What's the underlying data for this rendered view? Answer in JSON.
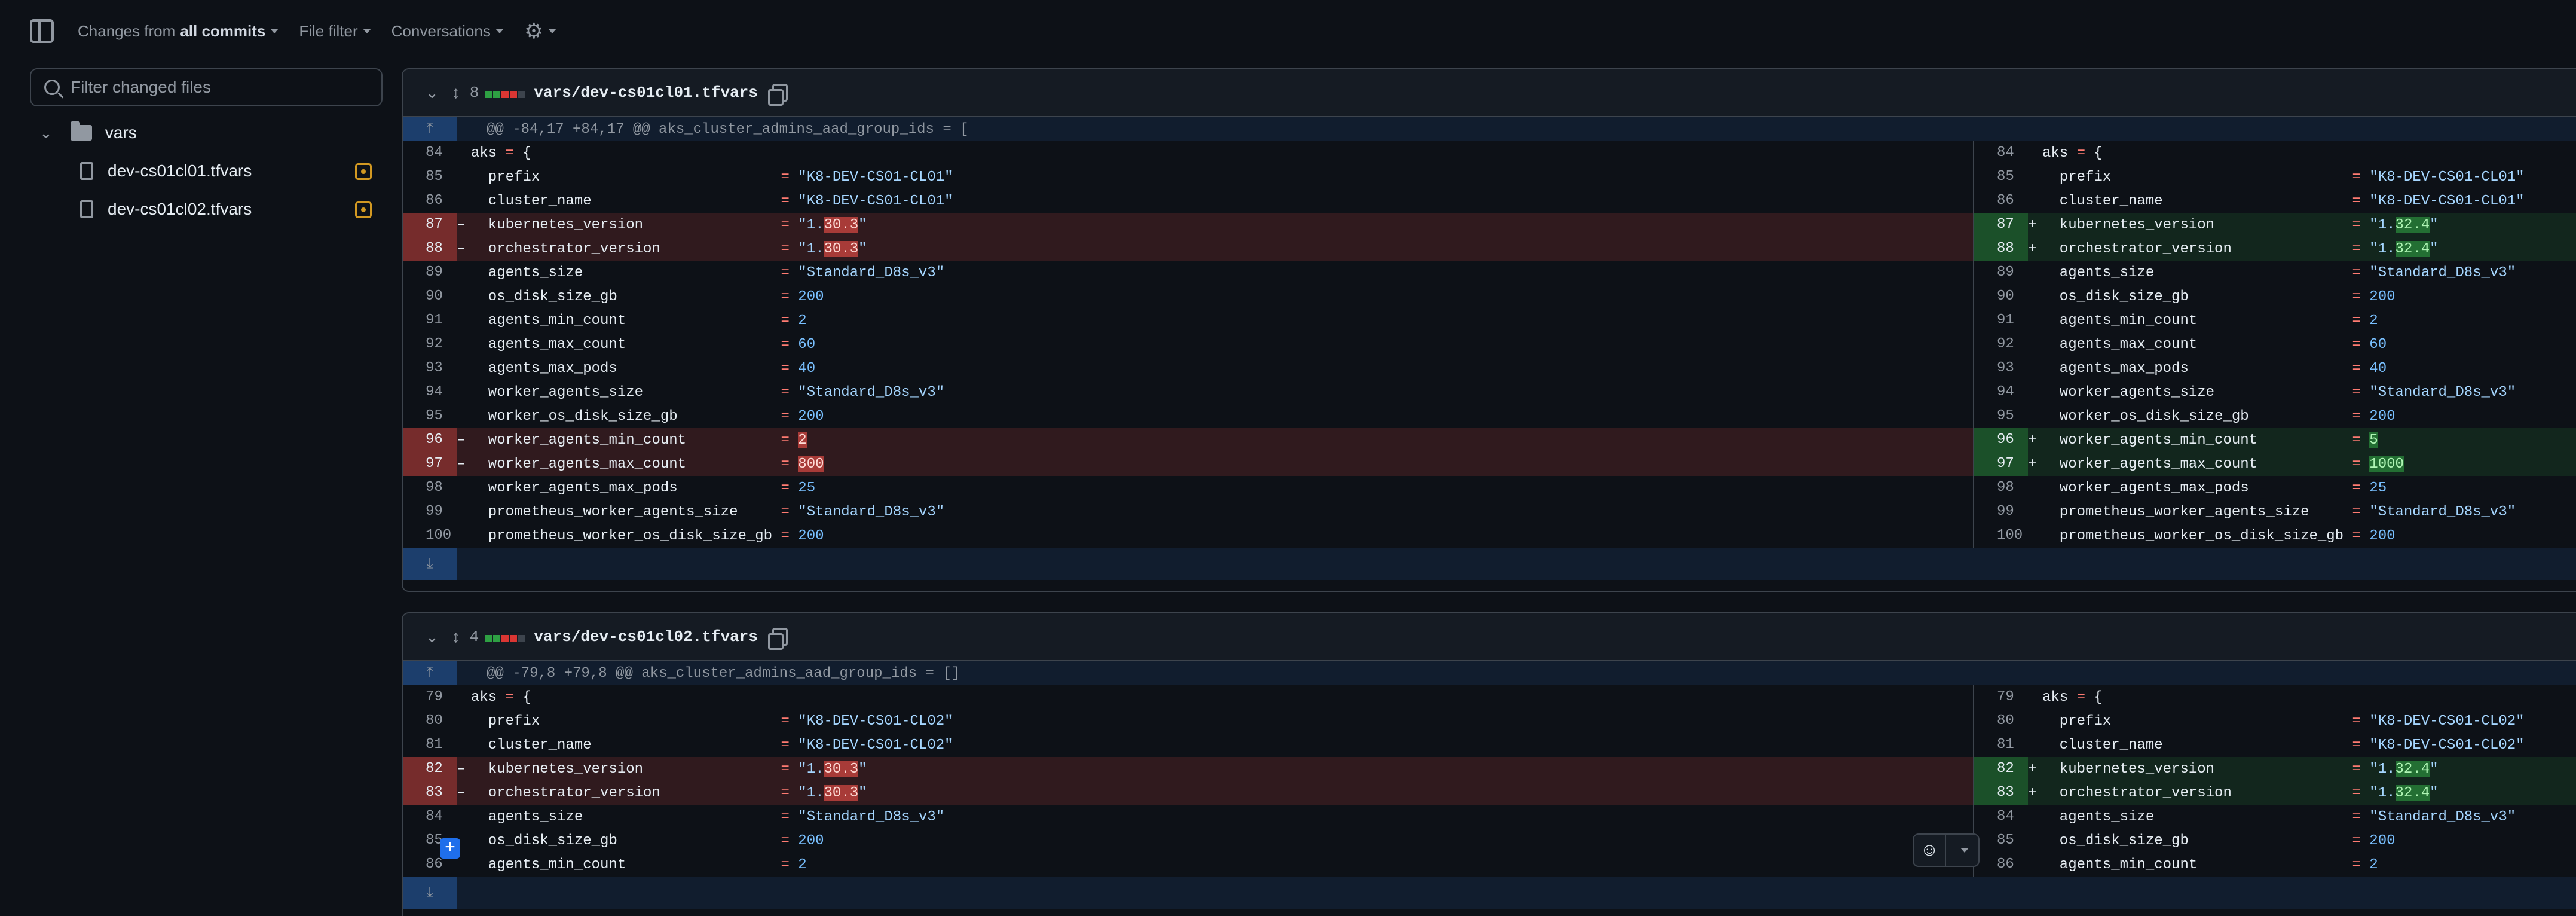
{
  "toolbar": {
    "changes_prefix": "Changes from",
    "changes_value": "all commits",
    "file_filter": "File filter",
    "conversations": "Conversations"
  },
  "sidebar": {
    "filter_placeholder": "Filter changed files",
    "folder": "vars",
    "files": [
      "dev-cs01cl01.tfvars",
      "dev-cs01cl02.tfvars"
    ]
  },
  "files": [
    {
      "count": "8",
      "path": "vars/dev-cs01cl01.tfvars",
      "hunk": "@@ -84,17 +84,17 @@ aks_cluster_admins_aad_group_ids = [",
      "lines": [
        {
          "ln": "84",
          "key": "aks",
          "type": "ctx"
        },
        {
          "ln": "85",
          "key": "prefix",
          "l": "\"K8-DEV-CS01-CL01\"",
          "r": "\"K8-DEV-CS01-CL01\"",
          "kind": "str",
          "type": "ctx"
        },
        {
          "ln": "86",
          "key": "cluster_name",
          "l": "\"K8-DEV-CS01-CL01\"",
          "r": "\"K8-DEV-CS01-CL01\"",
          "kind": "str",
          "type": "ctx"
        },
        {
          "ln": "87",
          "key": "kubernetes_version",
          "l": "\"1.30.3\"",
          "r": "\"1.32.4\"",
          "kind": "ver",
          "type": "chg"
        },
        {
          "ln": "88",
          "key": "orchestrator_version",
          "l": "\"1.30.3\"",
          "r": "\"1.32.4\"",
          "kind": "ver",
          "type": "chg"
        },
        {
          "ln": "89",
          "key": "agents_size",
          "l": "\"Standard_D8s_v3\"",
          "r": "\"Standard_D8s_v3\"",
          "kind": "str",
          "type": "ctx"
        },
        {
          "ln": "90",
          "key": "os_disk_size_gb",
          "l": "200",
          "r": "200",
          "kind": "num",
          "type": "ctx"
        },
        {
          "ln": "91",
          "key": "agents_min_count",
          "l": "2",
          "r": "2",
          "kind": "num",
          "type": "ctx"
        },
        {
          "ln": "92",
          "key": "agents_max_count",
          "l": "60",
          "r": "60",
          "kind": "num",
          "type": "ctx"
        },
        {
          "ln": "93",
          "key": "agents_max_pods",
          "l": "40",
          "r": "40",
          "kind": "num",
          "type": "ctx"
        },
        {
          "ln": "94",
          "key": "worker_agents_size",
          "l": "\"Standard_D8s_v3\"",
          "r": "\"Standard_D8s_v3\"",
          "kind": "str",
          "type": "ctx"
        },
        {
          "ln": "95",
          "key": "worker_os_disk_size_gb",
          "l": "200",
          "r": "200",
          "kind": "num",
          "type": "ctx"
        },
        {
          "ln": "96",
          "key": "worker_agents_min_count",
          "l": "2",
          "r": "5",
          "kind": "num",
          "type": "chg"
        },
        {
          "ln": "97",
          "key": "worker_agents_max_count",
          "l": "800",
          "r": "1000",
          "kind": "num",
          "type": "chg"
        },
        {
          "ln": "98",
          "key": "worker_agents_max_pods",
          "l": "25",
          "r": "25",
          "kind": "num",
          "type": "ctx"
        },
        {
          "ln": "99",
          "key": "prometheus_worker_agents_size",
          "l": "\"Standard_D8s_v3\"",
          "r": "\"Standard_D8s_v3\"",
          "kind": "str",
          "type": "ctx"
        },
        {
          "ln": "100",
          "key": "prometheus_worker_os_disk_size_gb",
          "l": "200",
          "r": "200",
          "kind": "num",
          "type": "ctx"
        }
      ]
    },
    {
      "count": "4",
      "path": "vars/dev-cs01cl02.tfvars",
      "hunk": "@@ -79,8 +79,8 @@ aks_cluster_admins_aad_group_ids = []",
      "lines": [
        {
          "ln": "79",
          "key": "aks",
          "type": "ctx"
        },
        {
          "ln": "80",
          "key": "prefix",
          "l": "\"K8-DEV-CS01-CL02\"",
          "r": "\"K8-DEV-CS01-CL02\"",
          "kind": "str",
          "type": "ctx"
        },
        {
          "ln": "81",
          "key": "cluster_name",
          "l": "\"K8-DEV-CS01-CL02\"",
          "r": "\"K8-DEV-CS01-CL02\"",
          "kind": "str",
          "type": "ctx"
        },
        {
          "ln": "82",
          "key": "kubernetes_version",
          "l": "\"1.30.3\"",
          "r": "\"1.32.4\"",
          "kind": "ver",
          "type": "chg"
        },
        {
          "ln": "83",
          "key": "orchestrator_version",
          "l": "\"1.30.3\"",
          "r": "\"1.32.4\"",
          "kind": "ver",
          "type": "chg"
        },
        {
          "ln": "84",
          "key": "agents_size",
          "l": "\"Standard_D8s_v3\"",
          "r": "\"Standard_D8s_v3\"",
          "kind": "str",
          "type": "ctx"
        },
        {
          "ln": "85",
          "key": "os_disk_size_gb",
          "l": "200",
          "r": "200",
          "kind": "num",
          "type": "ctx"
        },
        {
          "ln": "86",
          "key": "agents_min_count",
          "l": "2",
          "r": "2",
          "kind": "num",
          "type": "ctx"
        }
      ]
    }
  ],
  "symbols": {
    "del": "–",
    "add": "+",
    "eq": "=",
    "aks_brace": "= {"
  }
}
